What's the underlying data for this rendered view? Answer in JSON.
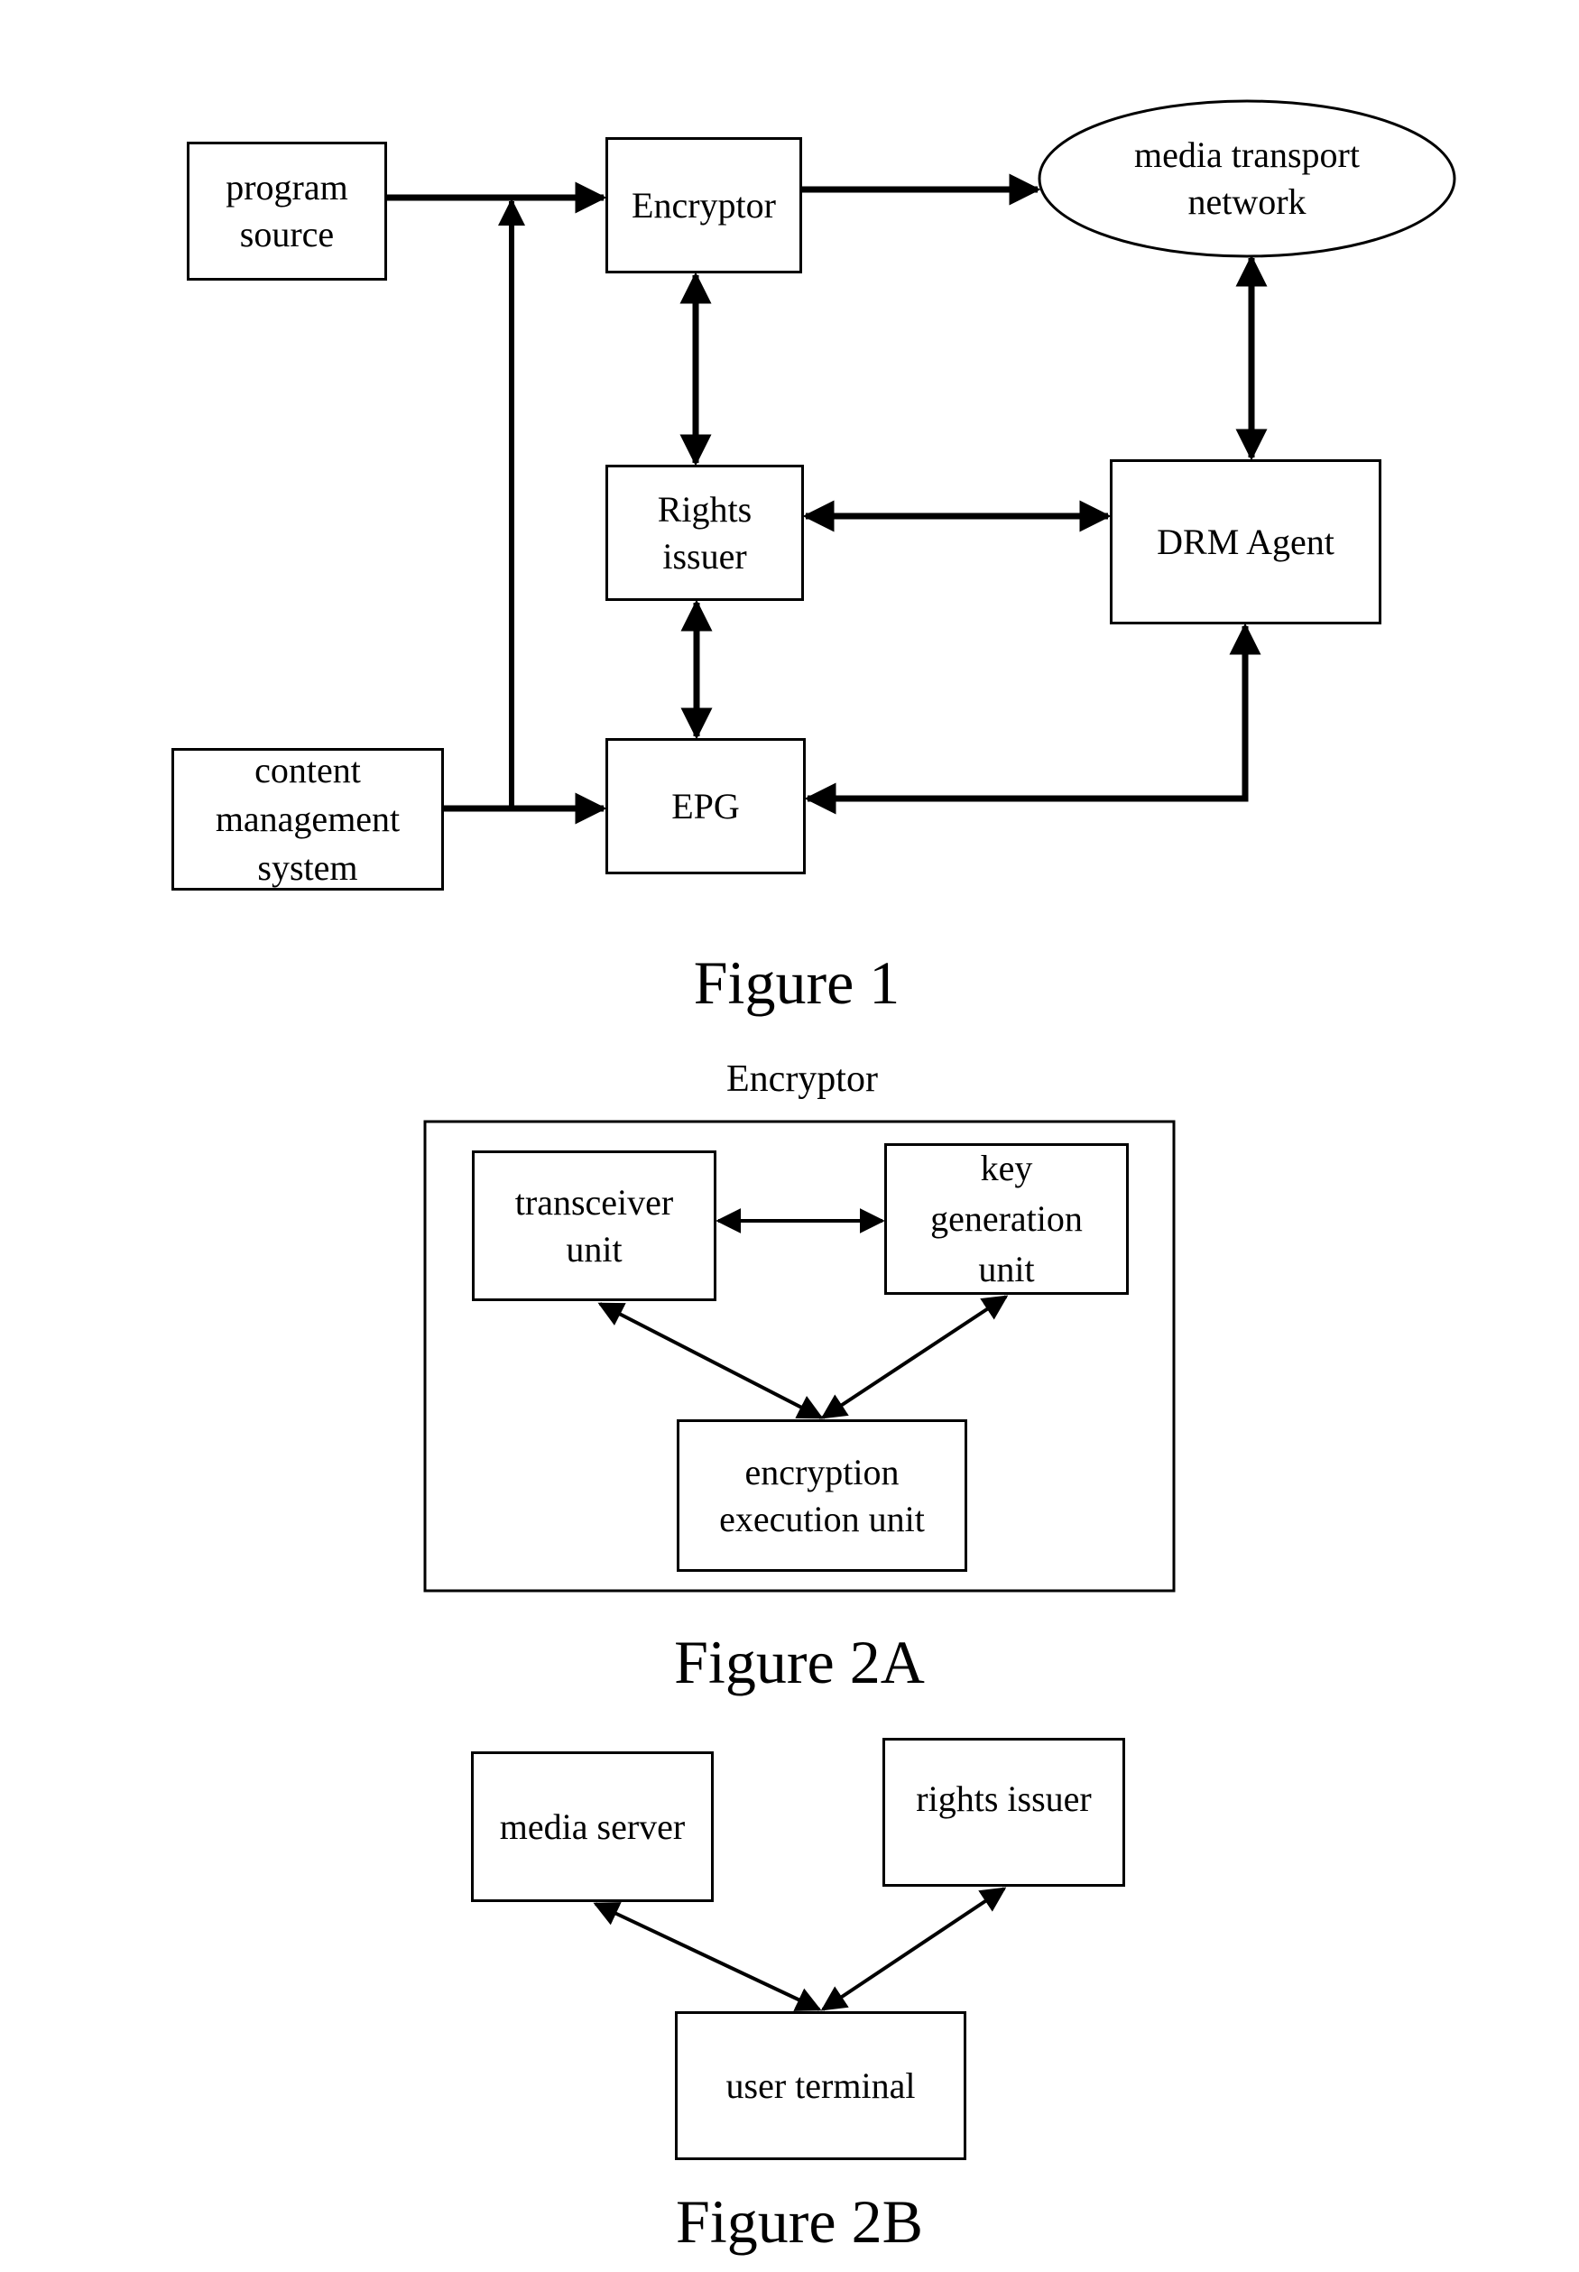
{
  "figure1": {
    "caption": "Figure 1",
    "nodes": {
      "program_source": "program\nsource",
      "encryptor": "Encryptor",
      "media_transport_network": "media transport\nnetwork",
      "rights_issuer": "Rights\nissuer",
      "drm_agent": "DRM Agent",
      "content_management_system": "content\nmanagement\nsystem",
      "epg": "EPG"
    },
    "edges": [
      {
        "from": "program_source",
        "to": "encryptor",
        "type": "one-way"
      },
      {
        "from": "content_management_system",
        "to": "encryptor",
        "type": "one-way"
      },
      {
        "from": "content_management_system",
        "to": "epg",
        "type": "one-way"
      },
      {
        "from": "encryptor",
        "to": "media_transport_network",
        "type": "one-way"
      },
      {
        "from": "encryptor",
        "to": "rights_issuer",
        "type": "two-way"
      },
      {
        "from": "rights_issuer",
        "to": "drm_agent",
        "type": "two-way"
      },
      {
        "from": "rights_issuer",
        "to": "epg",
        "type": "two-way"
      },
      {
        "from": "media_transport_network",
        "to": "drm_agent",
        "type": "two-way"
      },
      {
        "from": "drm_agent",
        "to": "epg",
        "type": "two-way"
      }
    ]
  },
  "figure2a": {
    "caption": "Figure 2A",
    "container_label": "Encryptor",
    "nodes": {
      "transceiver_unit": "transceiver\nunit",
      "key_generation_unit": "key\ngeneration\nunit",
      "encryption_execution_unit": "encryption\nexecution unit"
    },
    "edges": [
      {
        "from": "transceiver_unit",
        "to": "key_generation_unit",
        "type": "two-way"
      },
      {
        "from": "transceiver_unit",
        "to": "encryption_execution_unit",
        "type": "two-way"
      },
      {
        "from": "key_generation_unit",
        "to": "encryption_execution_unit",
        "type": "two-way"
      }
    ]
  },
  "figure2b": {
    "caption": "Figure 2B",
    "nodes": {
      "media_server": "media server",
      "rights_issuer": "rights issuer",
      "user_terminal": "user terminal"
    },
    "edges": [
      {
        "from": "media_server",
        "to": "user_terminal",
        "type": "two-way"
      },
      {
        "from": "rights_issuer",
        "to": "user_terminal",
        "type": "two-way"
      }
    ]
  }
}
